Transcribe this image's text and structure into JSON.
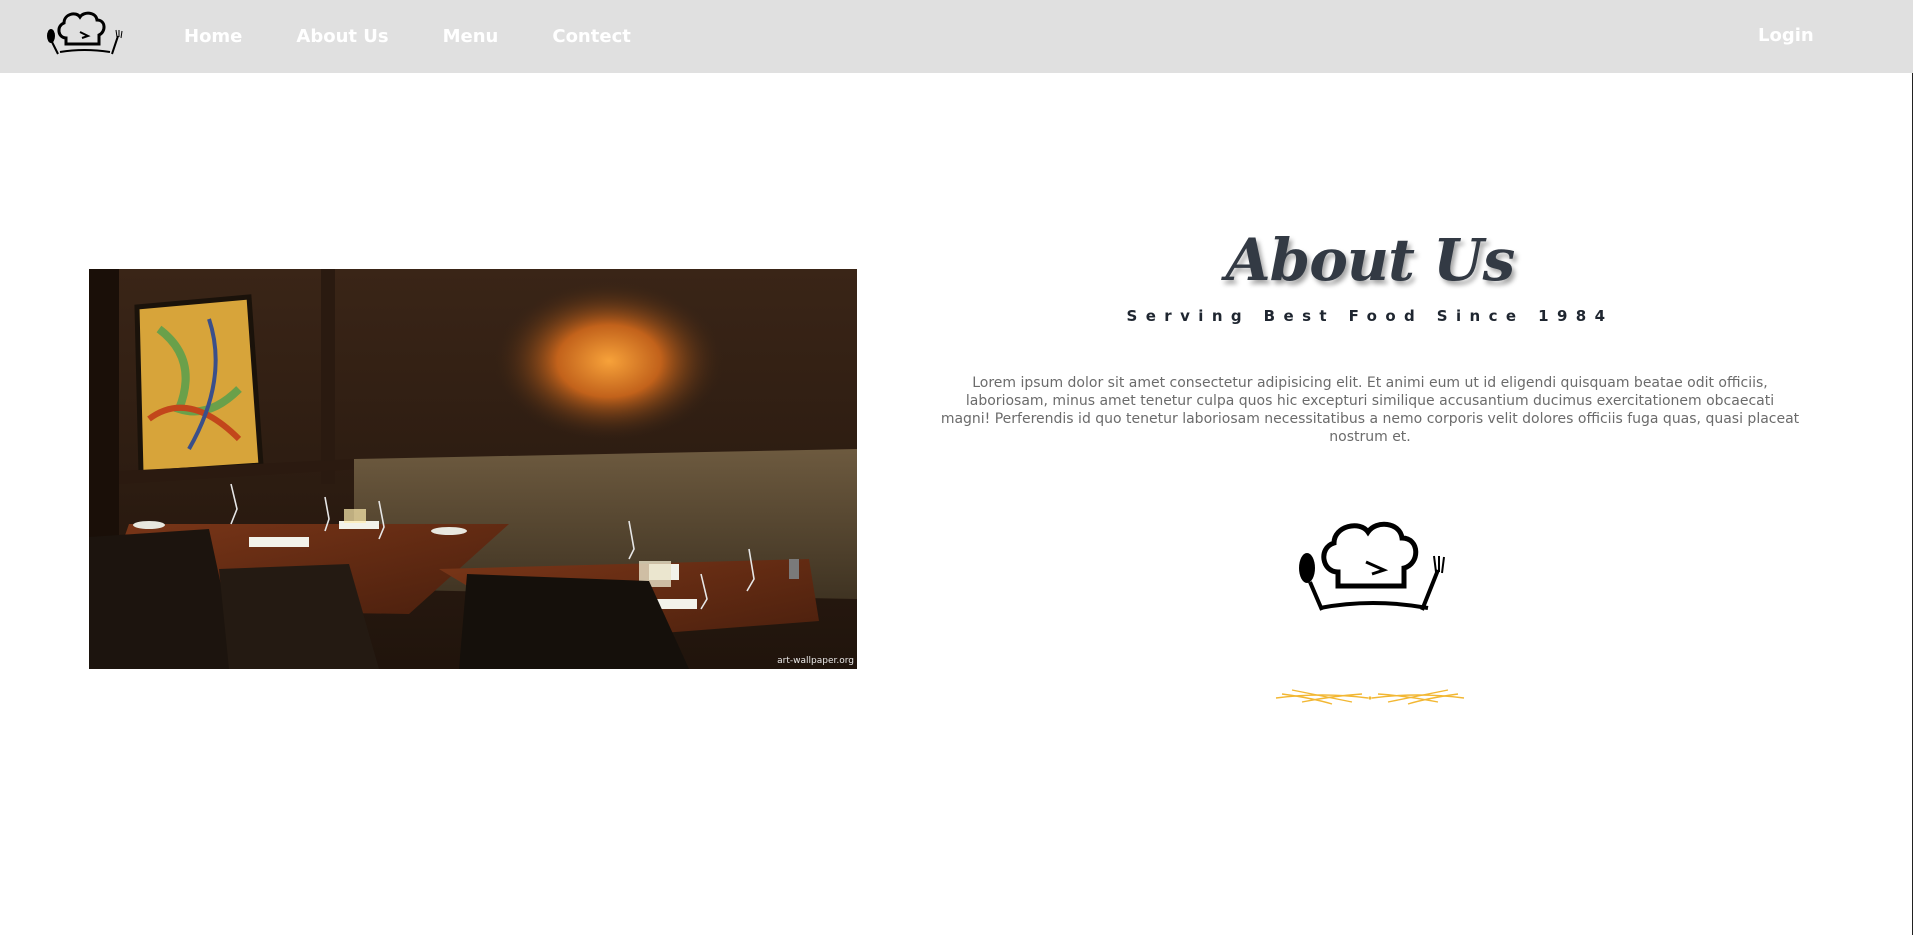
{
  "nav": {
    "logo_icon": "chef-hat-cutlery-icon",
    "links": [
      "Home",
      "About Us",
      "Menu",
      "Contect"
    ],
    "login": "Login"
  },
  "hero_photo": {
    "watermark": "art-wallpaper.org"
  },
  "about": {
    "title": "About Us",
    "subtitle": "Serving Best Food Since 1984",
    "text": "Lorem ipsum dolor sit amet consectetur adipisicing elit. Et animi eum ut id eligendi quisquam beatae odit officiis, laboriosam, minus amet tenetur culpa quos hic excepturi similique accusantium ducimus exercitationem obcaecati magni! Perferendis id quo tenetur laboriosam necessitatibus a nemo corporis velit dolores officiis fuga quas, quasi placeat nostrum et.",
    "logo_icon": "chef-hat-cutlery-icon",
    "divider_icon": "wheat-divider-icon"
  },
  "colors": {
    "navbar_bg": "#e0e0e0",
    "nav_text": "#ffffff",
    "title": "#333a44",
    "body_text": "#6b6b6b",
    "divider_gold": "#f2b733"
  }
}
